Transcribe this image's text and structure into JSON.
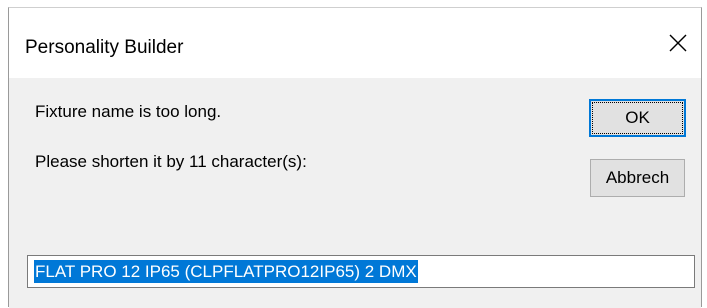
{
  "window": {
    "title": "Personality Builder",
    "close_icon": "close-icon"
  },
  "message": {
    "line1": "Fixture name is too long.",
    "line2": "Please shorten it by 11 character(s):"
  },
  "buttons": {
    "ok_label": "OK",
    "cancel_label": "Abbrech"
  },
  "input": {
    "value": "FLAT PRO 12 IP65 (CLPFLATPRO12IP65) 2 DMX",
    "selected": true
  },
  "colors": {
    "selection": "#0078d7",
    "focus_border": "#0078d7",
    "dialog_bg": "#f0f0f0"
  }
}
